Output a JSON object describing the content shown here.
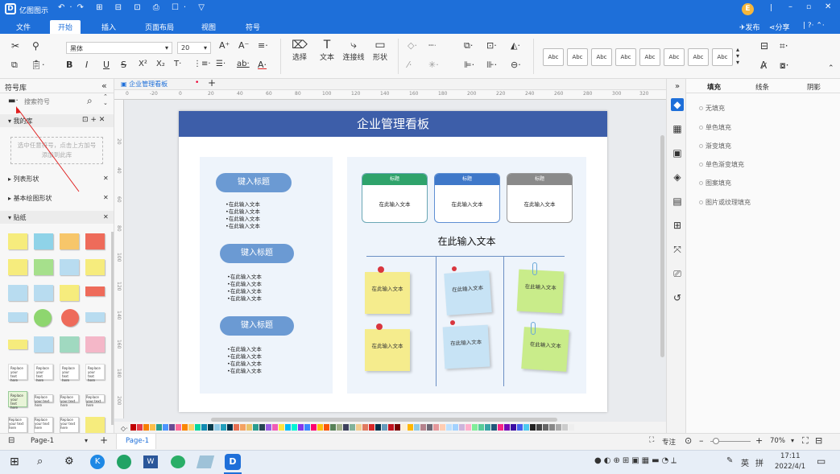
{
  "app": {
    "name": "亿图图示",
    "user_initial": "E",
    "top_right": {
      "publish": "发布",
      "share": "分享"
    }
  },
  "menu": {
    "file": "文件",
    "tabs": [
      "开始",
      "插入",
      "页面布局",
      "视图",
      "符号"
    ],
    "active_tab": "开始"
  },
  "ribbon": {
    "font": "黑体",
    "font_size": "20",
    "tools": {
      "select": "选择",
      "text": "文本",
      "connector": "连接线",
      "shape": "形状"
    },
    "style_label": "Abc"
  },
  "left_panel": {
    "title": "符号库",
    "search_placeholder": "搜索符号",
    "my_library": "我的库",
    "hint": "选中任意符号，点击上方加号添加到此库",
    "list_shapes": "列表形状",
    "basic_shapes": "基本绘图形状",
    "sticker": "贴纸",
    "sticky_text": "Replace your text here"
  },
  "document": {
    "tab_title": "企业管理看板",
    "ruler_top": [
      "0",
      "-20",
      "0",
      "20",
      "40",
      "60",
      "80",
      "100",
      "120",
      "140",
      "160",
      "180",
      "200",
      "220",
      "240",
      "260",
      "280",
      "300",
      "320"
    ],
    "ruler_left": [
      "20",
      "40",
      "60",
      "80",
      "100",
      "120",
      "140",
      "160",
      "180",
      "200"
    ]
  },
  "diagram": {
    "title": "企业管理看板",
    "pill_label": "键入标题",
    "bullet_text": "在此输入文本",
    "card_header": "标题",
    "card_body": "在此输入文本",
    "section_title": "在此输入文本",
    "note_text": "在此输入文本",
    "colors": {
      "header": "#3d5ea9",
      "panel": "#eef4fb",
      "pill": "#6b9ad3",
      "card_green": "#2fa36b",
      "card_blue": "#3f78c9",
      "card_gray": "#8a8a8a",
      "yellow_note": "#f5ec8d",
      "blue_note": "#c7e3f5",
      "green_note": "#c9ec8a"
    }
  },
  "right_panel": {
    "tabs": [
      "填充",
      "线条",
      "阴影"
    ],
    "active_tab": "填充",
    "options": [
      "无填充",
      "单色填充",
      "渐变填充",
      "单色渐变填充",
      "图案填充",
      "图片或纹理填充"
    ]
  },
  "status": {
    "page_select": "Page-1",
    "page_tab": "Page-1",
    "focus": "专注",
    "zoom": "70%"
  },
  "taskbar": {
    "time": "17:11",
    "date": "2022/4/1",
    "ime": "英",
    "ime2": "拼"
  }
}
